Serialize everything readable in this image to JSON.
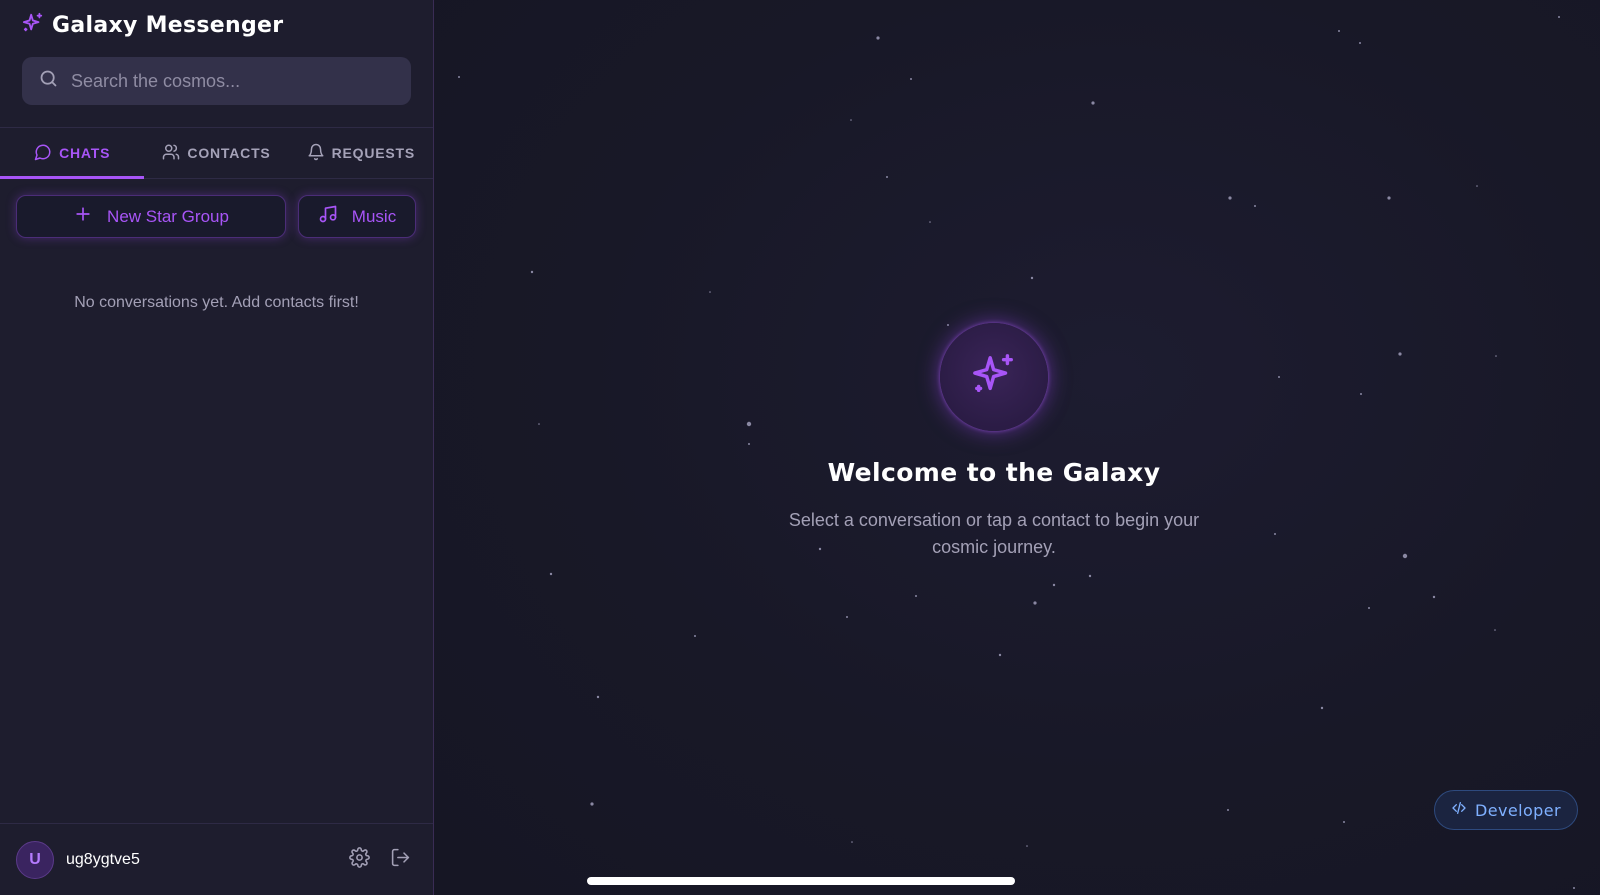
{
  "app": {
    "title": "Galaxy Messenger"
  },
  "search": {
    "placeholder": "Search the cosmos..."
  },
  "tabs": [
    {
      "label": "CHATS",
      "icon": "chat-bubble-icon",
      "active": true
    },
    {
      "label": "CONTACTS",
      "icon": "users-icon",
      "active": false
    },
    {
      "label": "REQUESTS",
      "icon": "bell-icon",
      "active": false
    }
  ],
  "actions": {
    "new_group_label": "New Star Group",
    "music_label": "Music"
  },
  "chats": {
    "empty_text": "No conversations yet. Add contacts first!"
  },
  "user": {
    "avatar_initial": "U",
    "name": "ug8ygtve5"
  },
  "welcome": {
    "title": "Welcome to the Galaxy",
    "subtitle": "Select a conversation or tap a contact to begin your cosmic journey."
  },
  "developer": {
    "label": "Developer"
  },
  "colors": {
    "accent": "#a855f7",
    "sidebar_bg": "#1e1d2e",
    "main_bg": "#181827",
    "developer_text": "#7fb0ff"
  }
}
